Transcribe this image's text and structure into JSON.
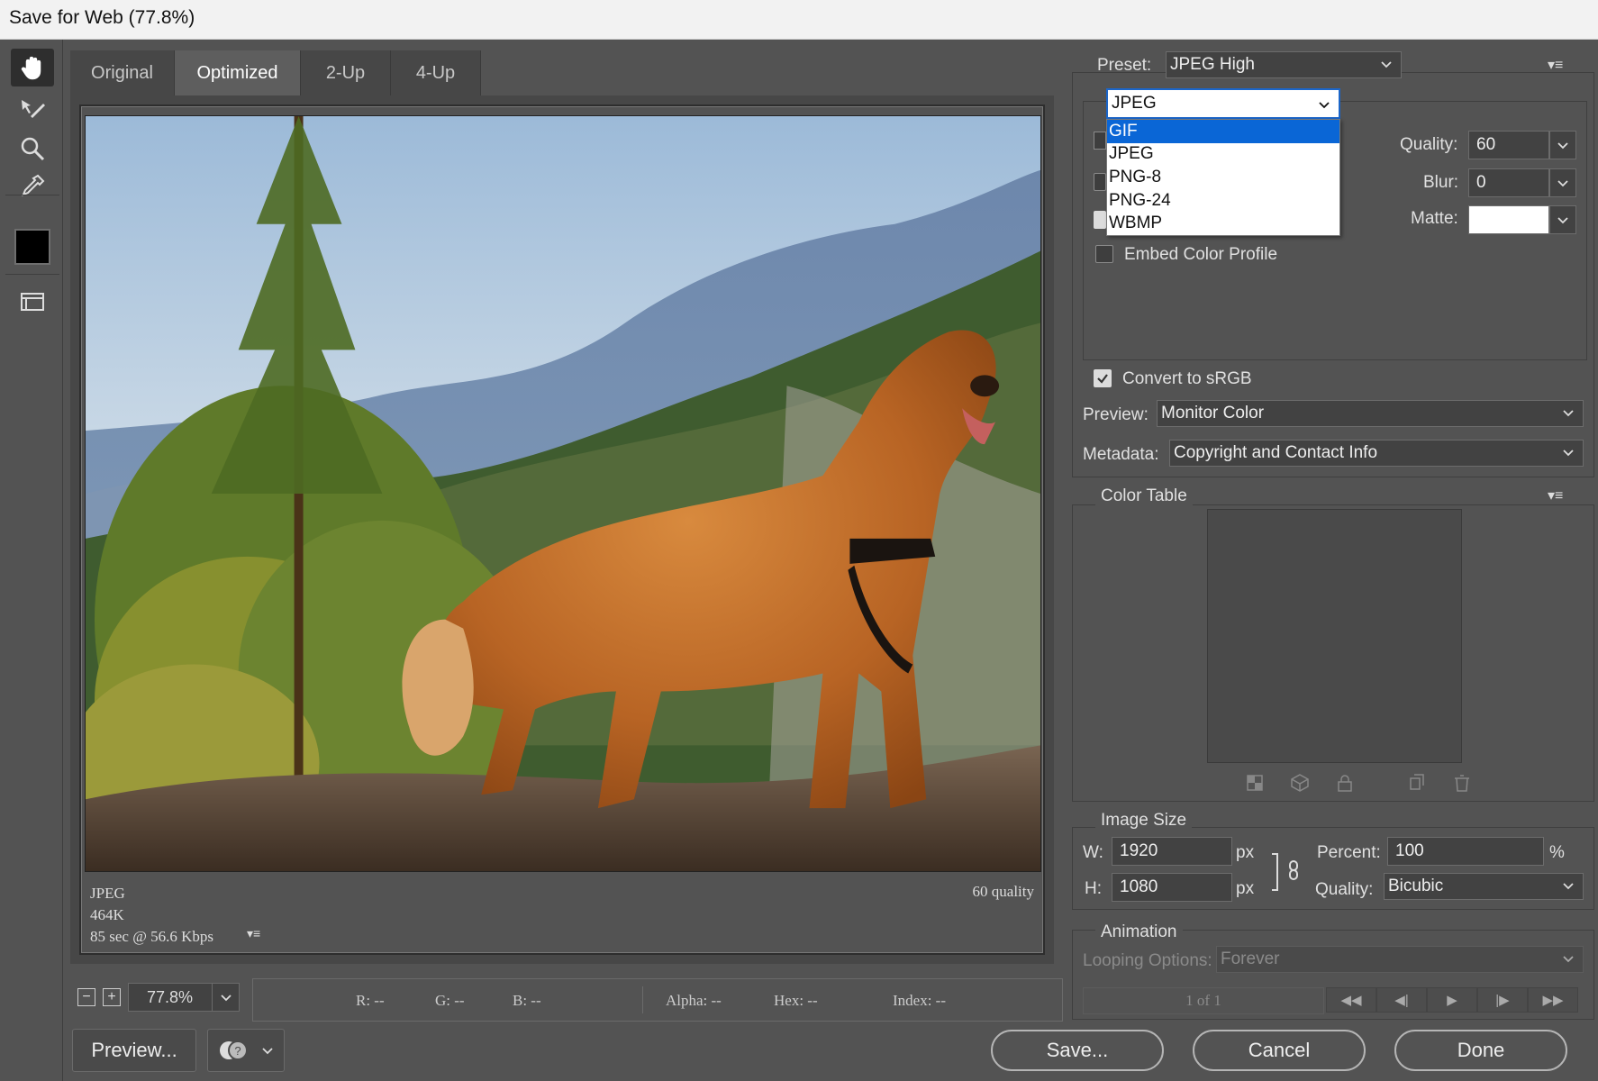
{
  "window": {
    "title": "Save for Web (77.8%)"
  },
  "tools": {
    "hand": "hand-tool-icon",
    "slice_select": "slice-select-icon",
    "zoom": "zoom-icon",
    "eyedropper": "eyedropper-icon",
    "toggle_slices": "toggle-slices-icon"
  },
  "tabs": [
    {
      "label": "Original"
    },
    {
      "label": "Optimized"
    },
    {
      "label": "2-Up"
    },
    {
      "label": "4-Up"
    }
  ],
  "preview": {
    "format": "JPEG",
    "size": "464K",
    "download": "85 sec @ 56.6 Kbps",
    "quality": "60 quality",
    "menu": "▾≡"
  },
  "status": {
    "zoom": "77.8%",
    "r": "R: --",
    "g": "G: --",
    "b": "B: --",
    "alpha": "Alpha: --",
    "hex": "Hex: --",
    "index": "Index: --"
  },
  "buttons": {
    "preview": "Preview...",
    "save": "Save...",
    "cancel": "Cancel",
    "done": "Done"
  },
  "settings": {
    "preset_label": "Preset:",
    "preset_value": "JPEG High",
    "format_value": "JPEG",
    "format_options": [
      "GIF",
      "JPEG",
      "PNG-8",
      "PNG-24",
      "WBMP"
    ],
    "format_highlight": "GIF",
    "quality_label": "Quality:",
    "quality_value": "60",
    "blur_label": "Blur:",
    "blur_value": "0",
    "matte_label": "Matte:",
    "matte_color": "#ffffff",
    "embed_profile_label": "Embed Color Profile",
    "embed_profile_checked": false,
    "convert_srgb_label": "Convert to sRGB",
    "convert_srgb_checked": true,
    "preview_label": "Preview:",
    "preview_value": "Monitor Color",
    "metadata_label": "Metadata:",
    "metadata_value": "Copyright and Contact Info"
  },
  "color_table": {
    "title": "Color Table"
  },
  "image_size": {
    "title": "Image Size",
    "w_label": "W:",
    "w_value": "1920",
    "h_label": "H:",
    "h_value": "1080",
    "unit": "px",
    "percent_label": "Percent:",
    "percent_value": "100",
    "percent_unit": "%",
    "quality_label": "Quality:",
    "quality_value": "Bicubic"
  },
  "animation": {
    "title": "Animation",
    "looping_label": "Looping Options:",
    "looping_value": "Forever",
    "frame": "1 of 1"
  },
  "colors": {
    "accent": "#0a66d6",
    "panel": "#535353"
  }
}
